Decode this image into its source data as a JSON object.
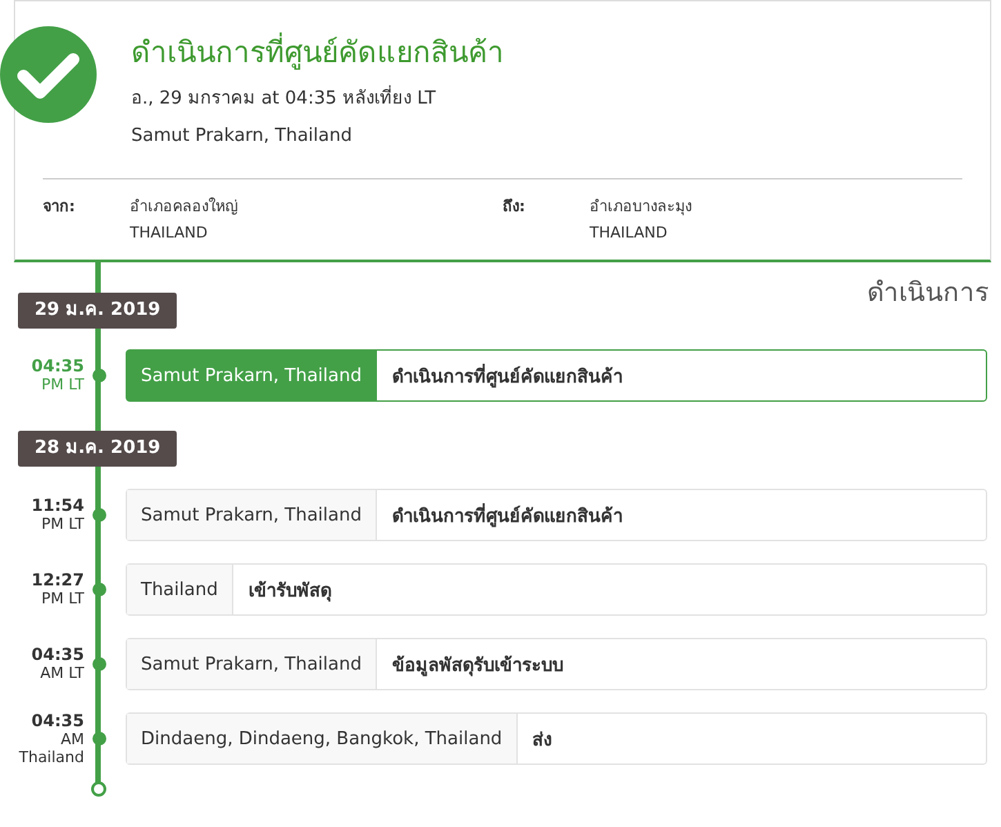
{
  "header": {
    "title": "ดำเนินการที่ศูนย์คัดแยกสินค้า",
    "datetime": "อ., 29 มกราคม at 04:35 หลังเที่ยง LT",
    "location": "Samut Prakarn, Thailand",
    "from": {
      "label": "จาก:",
      "place": "อำเภอคลองใหญ่",
      "country": "THAILAND"
    },
    "to": {
      "label": "ถึง:",
      "place": "อำเภอบางละมุง",
      "country": "THAILAND"
    }
  },
  "status_heading": "ดำเนินการ",
  "groups": [
    {
      "date": "29 ม.ค. 2019",
      "events": [
        {
          "time": "04:35",
          "suffix": [
            "PM LT"
          ],
          "place": "Samut Prakarn, Thailand",
          "status": "ดำเนินการที่ศูนย์คัดแยกสินค้า",
          "selected": true
        }
      ]
    },
    {
      "date": "28 ม.ค. 2019",
      "events": [
        {
          "time": "11:54",
          "suffix": [
            "PM LT"
          ],
          "place": "Samut Prakarn, Thailand",
          "status": "ดำเนินการที่ศูนย์คัดแยกสินค้า",
          "selected": false
        },
        {
          "time": "12:27",
          "suffix": [
            "PM LT"
          ],
          "place": "Thailand",
          "status": "เข้ารับพัสดุ",
          "selected": false
        },
        {
          "time": "04:35",
          "suffix": [
            "AM LT"
          ],
          "place": "Samut Prakarn, Thailand",
          "status": "ข้อมูลพัสดุรับเข้าระบบ",
          "selected": false
        },
        {
          "time": "04:35",
          "suffix": [
            "AM",
            "Thailand"
          ],
          "place": "Dindaeng, Dindaeng, Bangkok, Thailand",
          "status": "ส่ง",
          "selected": false
        }
      ]
    }
  ]
}
